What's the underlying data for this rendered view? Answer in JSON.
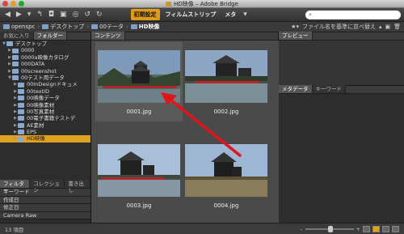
{
  "window": {
    "title": "HD映像 – Adobe Bridge"
  },
  "toolbar": {
    "workspaces": [
      "初期設定",
      "フィルムストリップ",
      "メタ"
    ],
    "workspace_menu": "▾",
    "search_placeholder": "⌕"
  },
  "path": {
    "items": [
      "openspc",
      "デスクトップ",
      "00テータ",
      "HD映像"
    ],
    "sort_label": "ファイル名を基準に並べ替え"
  },
  "left": {
    "tabs": [
      "お気に入り",
      "フォルダー"
    ],
    "tree": [
      {
        "label": "デスクトップ",
        "indent": 0,
        "open": true
      },
      {
        "label": "0000",
        "indent": 1
      },
      {
        "label": "0000a映像カタログ",
        "indent": 1
      },
      {
        "label": "000DATA",
        "indent": 1
      },
      {
        "label": "00screenshot",
        "indent": 1
      },
      {
        "label": "00テスト用データ",
        "indent": 1,
        "open": true
      },
      {
        "label": "00InDesignドキュメ",
        "indent": 2
      },
      {
        "label": "00textID",
        "indent": 2
      },
      {
        "label": "00映像データ",
        "indent": 2
      },
      {
        "label": "00映像素材",
        "indent": 2
      },
      {
        "label": "00写真素材",
        "indent": 2
      },
      {
        "label": "00電子書籍テストデ",
        "indent": 2
      },
      {
        "label": "AE素材",
        "indent": 2
      },
      {
        "label": "EPS",
        "indent": 2
      },
      {
        "label": "HD映像",
        "indent": 2,
        "selected": true
      }
    ],
    "filter_tabs": [
      "フィルター",
      "コレクション",
      "書き出し"
    ],
    "filters": [
      "キーワード",
      "作成日",
      "修正日",
      "Camera Raw"
    ]
  },
  "content": {
    "tab": "コンテンツ",
    "thumbs": [
      {
        "name": "0001.jpg",
        "selected": true
      },
      {
        "name": "0002.jpg"
      },
      {
        "name": "0003.jpg"
      },
      {
        "name": "0004.jpg"
      }
    ]
  },
  "right": {
    "preview_tab": "プレビュー",
    "meta_tabs": [
      "メタデータ",
      "キーワード"
    ]
  },
  "status": {
    "count": "13 項目"
  },
  "colors": {
    "accent": "#e0a020",
    "arrow": "#e0141a"
  }
}
